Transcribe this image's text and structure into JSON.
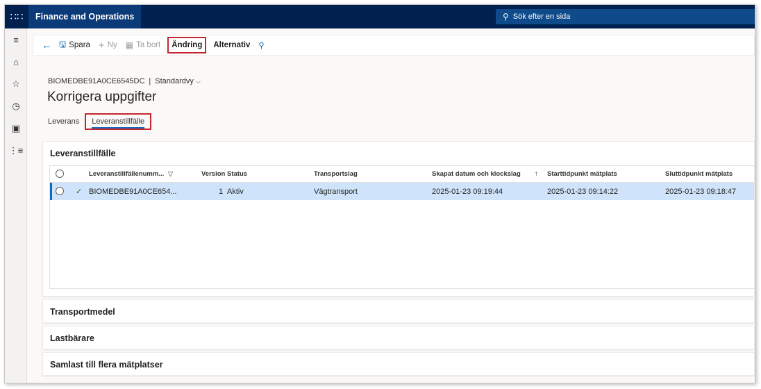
{
  "header": {
    "app_title": "Finance and Operations",
    "search_placeholder": "Sök efter en sida"
  },
  "toolbar": {
    "save_label": "Spara",
    "new_label": "Ny",
    "delete_label": "Ta bort",
    "edit_label": "Ändring",
    "options_label": "Alternativ"
  },
  "breadcrumb": {
    "record_id": "BIOMEDBE91A0CE6545DC",
    "separator": "|",
    "view": "Standardvy"
  },
  "page": {
    "title": "Korrigera uppgifter"
  },
  "tabs": [
    {
      "label": "Leverans",
      "active": false
    },
    {
      "label": "Leveranstillfälle",
      "active": true
    }
  ],
  "grid_section": {
    "title": "Leveranstillfälle",
    "columns": [
      "Leveranstillfällenumm...",
      "Version",
      "Status",
      "Transportslag",
      "Skapat datum och klockslag",
      "Starttidpunkt mätplats",
      "Sluttidpunkt mätplats"
    ],
    "rows": [
      {
        "number": "BIOMEDBE91A0CE654...",
        "version": "1",
        "status": "Aktiv",
        "transport": "Vägtransport",
        "created": "2025-01-23 09:19:44",
        "start": "2025-01-23 09:14:22",
        "end": "2025-01-23 09:18:47"
      }
    ]
  },
  "sections": [
    {
      "title": "Transportmedel"
    },
    {
      "title": "Lastbärare"
    },
    {
      "title": "Samlast till flera mätplatser"
    }
  ],
  "colors": {
    "topbar": "#002050",
    "accent": "#0f6cbd",
    "highlight_box": "#c4262e",
    "selected_row": "#cfe4fa"
  }
}
